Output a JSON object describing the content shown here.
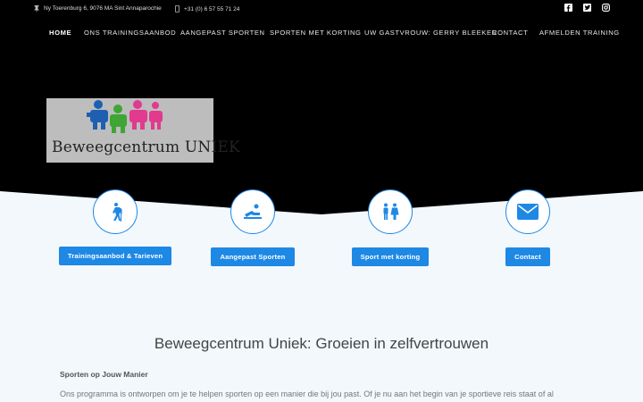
{
  "topbar": {
    "address": "Ny Toerenburg 6, 9076 MA Sint Annaparochie",
    "phone": "+31 (0) 6 57 55 71 24",
    "social_icons": [
      "facebook-icon",
      "twitter-icon",
      "instagram-icon"
    ]
  },
  "nav": {
    "items": [
      {
        "label": "HOME"
      },
      {
        "label": "ONS TRAININGSAANBOD"
      },
      {
        "label": "AANGEPAST SPORTEN"
      },
      {
        "label": "SPORTEN MET KORTING"
      },
      {
        "label": "UW GASTVROUW: GERRY BLEEKER"
      },
      {
        "label": "CONTACT"
      },
      {
        "label": "AFMELDEN TRAINING"
      }
    ]
  },
  "logo": {
    "text": "Beweegcentrum UNIEK"
  },
  "features": [
    {
      "icon": "hiker-icon",
      "label": "Trainingsaanbod & Tarieven"
    },
    {
      "icon": "accessible-icon",
      "label": "Aangepast Sporten"
    },
    {
      "icon": "people-icon",
      "label": "Sport met korting"
    },
    {
      "icon": "mail-icon",
      "label": "Contact"
    }
  ],
  "content": {
    "title": "Beweegcentrum Uniek: Groeien in zelfvertrouwen",
    "subheading": "Sporten op Jouw Manier",
    "paragraph": "Ons programma is ontworpen om je te helpen sporten op een manier die bij jou past. Of je nu aan het begin van je sportieve reis staat of al"
  },
  "colors": {
    "accent": "#1e88e5",
    "header_bg": "#000000",
    "page_bg": "#f2f8fc"
  }
}
